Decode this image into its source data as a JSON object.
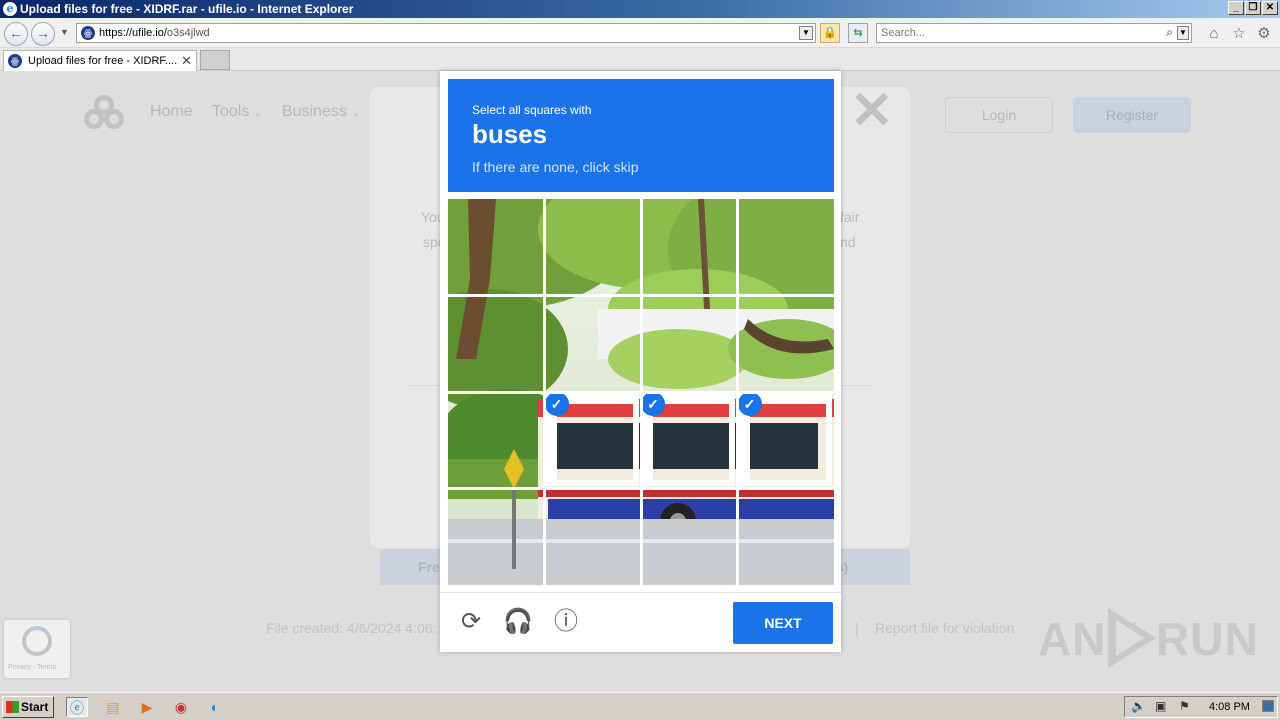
{
  "window": {
    "title": "Upload files for free - XIDRF.rar - ufile.io - Internet Explorer"
  },
  "addressbar": {
    "url_main": "https://ufile.io/",
    "url_path": "o3s4jlwd",
    "search_placeholder": "Search..."
  },
  "tabs": [
    {
      "label": "Upload files for free - XIDRF...."
    }
  ],
  "site": {
    "nav": [
      "Home",
      "Tools",
      "Business"
    ],
    "login": "Login",
    "register": "Register",
    "dialog_text_left_1": "You",
    "dialog_text_left_2": "spe",
    "dialog_text_right_1": "fair",
    "dialog_text_right_2": "nd",
    "free_label": "Fre",
    "free_speed_suffix": "/s)",
    "file_created": "File created: 4/6/2024 4:06:",
    "report": "Report file for violation",
    "separator": "|",
    "recaptcha_badge_text": "Privacy - Terms"
  },
  "captcha": {
    "instruction_line1": "Select all squares with",
    "target": "buses",
    "instruction_line3": "If there are none, click skip",
    "next_label": "NEXT",
    "grid_size": 4,
    "selected_tiles": [
      9,
      10,
      11
    ],
    "icons": [
      "refresh-icon",
      "audio-icon",
      "info-icon"
    ]
  },
  "watermark": {
    "left": "ANY",
    "right": "RUN"
  },
  "taskbar": {
    "start": "Start",
    "clock": "4:08 PM"
  },
  "colors": {
    "captcha_blue": "#1a73e8",
    "titlebar_blue": "#0a246a"
  }
}
